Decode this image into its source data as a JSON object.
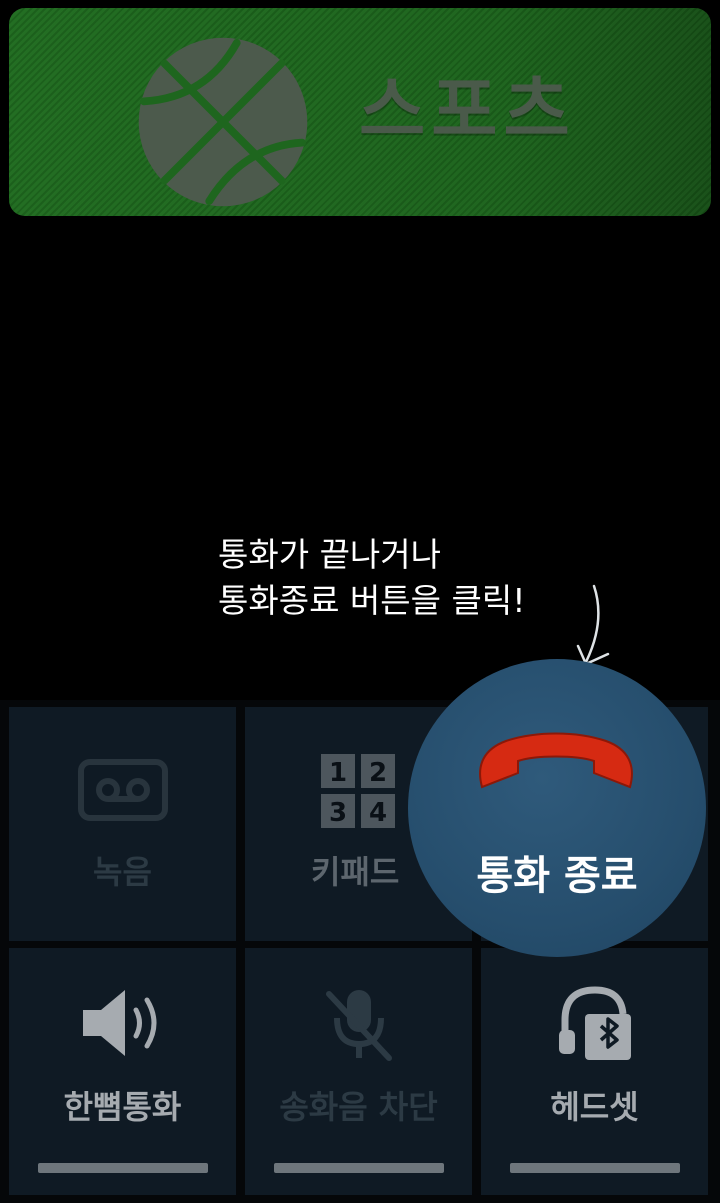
{
  "banner": {
    "title": "스포츠",
    "icon": "basketball-icon"
  },
  "hint": {
    "line1": "통화가 끝나거나",
    "line2": "통화종료 버튼을 클릭!"
  },
  "keypad_digits": [
    "1",
    "2",
    "3",
    "4"
  ],
  "buttons": {
    "record": {
      "label": "녹음",
      "icon": "cassette-icon"
    },
    "keypad": {
      "label": "키패드",
      "icon": "keypad-icon"
    },
    "end_call": {
      "label": "통화 종료",
      "icon": "hang-up-icon",
      "color": "#d62a12"
    },
    "speaker": {
      "label": "한뼘통화",
      "icon": "speaker-icon"
    },
    "mute": {
      "label": "송화음 차단",
      "icon": "mute-mic-icon"
    },
    "headset": {
      "label": "헤드셋",
      "icon": "bluetooth-headset-icon"
    }
  }
}
